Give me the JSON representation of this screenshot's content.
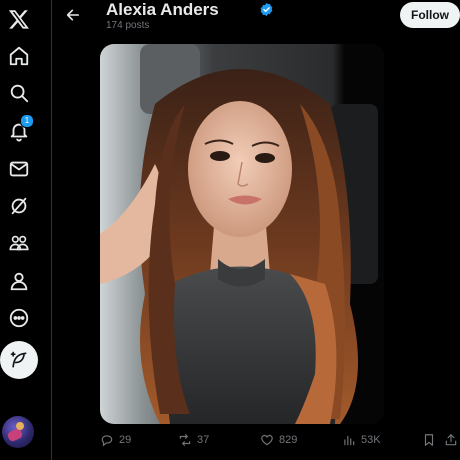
{
  "profile": {
    "name": "Alexia Anders",
    "posts_label": "174 posts",
    "verified": true
  },
  "header": {
    "follow_label": "Follow"
  },
  "nav": {
    "items": [
      {
        "name": "x-logo-icon"
      },
      {
        "name": "home-icon"
      },
      {
        "name": "search-icon"
      },
      {
        "name": "notifications-icon",
        "badge": "1"
      },
      {
        "name": "messages-icon"
      },
      {
        "name": "grok-icon"
      },
      {
        "name": "communities-icon"
      },
      {
        "name": "profile-icon"
      },
      {
        "name": "more-icon"
      }
    ],
    "compose": "compose-post-icon"
  },
  "post": {
    "replies": "29",
    "reposts": "37",
    "likes": "829",
    "views": "53K"
  },
  "colors": {
    "background": "#000000",
    "accent": "#1d9bf0",
    "text": "#e7e9ea",
    "muted": "#71767b",
    "border": "#2f3336"
  }
}
